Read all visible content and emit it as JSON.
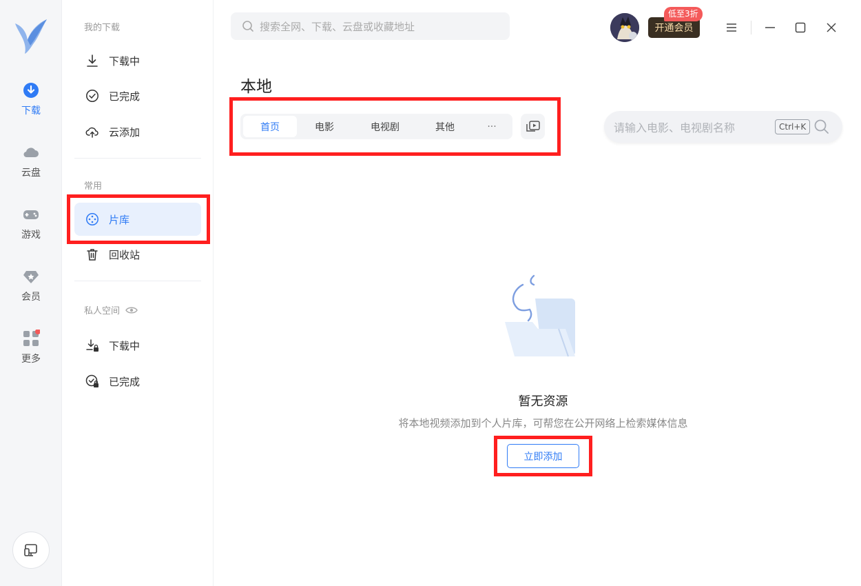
{
  "rail": {
    "items": [
      {
        "label": "下载",
        "icon": "download-icon",
        "active": true
      },
      {
        "label": "云盘",
        "icon": "cloud-icon"
      },
      {
        "label": "游戏",
        "icon": "gamepad-icon"
      },
      {
        "label": "会员",
        "icon": "diamond-icon"
      },
      {
        "label": "更多",
        "icon": "apps-grid-icon"
      }
    ]
  },
  "sidebar": {
    "group_downloads": "我的下载",
    "downloading": "下载中",
    "completed": "已完成",
    "cloud_add": "云添加",
    "group_common": "常用",
    "library": "片库",
    "recycle": "回收站",
    "group_private": "私人空间",
    "private_downloading": "下载中",
    "private_completed": "已完成"
  },
  "topbar": {
    "search_placeholder": "搜索全网、下载、云盘或收藏地址",
    "vip_button": "开通会员",
    "vip_badge": "低至3折"
  },
  "main": {
    "title": "本地",
    "tabs": [
      {
        "label": "首页",
        "active": true
      },
      {
        "label": "电影"
      },
      {
        "label": "电视剧"
      },
      {
        "label": "其他"
      },
      {
        "label": "···"
      }
    ],
    "film_search_placeholder": "请输入电影、电视剧名称",
    "shortcut": "Ctrl+K",
    "empty_title": "暂无资源",
    "empty_desc": "将本地视频添加到个人片库，可帮您在公开网络上检索媒体信息",
    "add_button": "立即添加"
  },
  "colors": {
    "accent": "#2f7bf5",
    "highlight": "#ff1f1f",
    "badge": "#f45a5a"
  }
}
